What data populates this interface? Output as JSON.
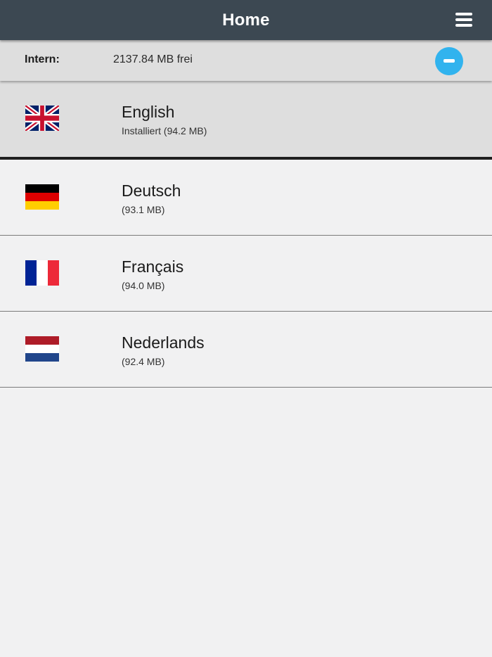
{
  "header": {
    "title": "Home",
    "menu_icon": "hamburger-menu-icon"
  },
  "storage": {
    "label": "Intern:",
    "value": "2137.84 MB frei",
    "remove_icon": "minus-circle-icon",
    "accent_color": "#31b3ee"
  },
  "languages": [
    {
      "name": "English",
      "size": "Installiert (94.2 MB)",
      "flag": "uk-flag-icon",
      "selected": true
    },
    {
      "name": "Deutsch",
      "size": "(93.1 MB)",
      "flag": "germany-flag-icon",
      "selected": false
    },
    {
      "name": "Français",
      "size": "(94.0 MB)",
      "flag": "france-flag-icon",
      "selected": false
    },
    {
      "name": "Nederlands",
      "size": "(92.4 MB)",
      "flag": "netherlands-flag-icon",
      "selected": false
    }
  ],
  "colors": {
    "header_bg": "#3c4852",
    "selected_row_bg": "#dedede",
    "page_bg": "#f1f1f2"
  }
}
